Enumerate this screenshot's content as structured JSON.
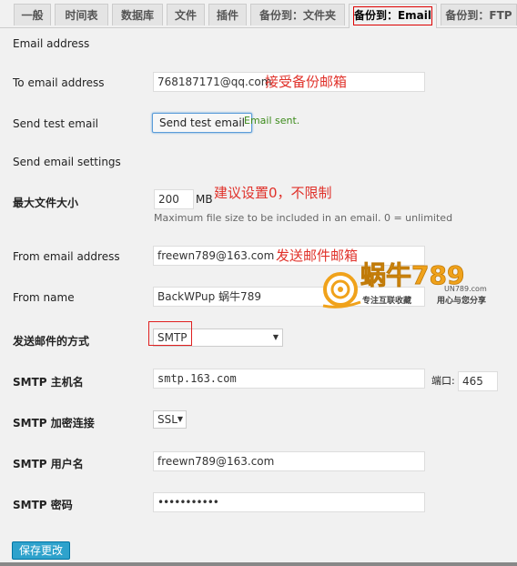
{
  "tabs": [
    "一般",
    "时间表",
    "数据库",
    "文件",
    "插件",
    "备份到：文件夹",
    "备份到：Email",
    "备份到：FTP"
  ],
  "sections": {
    "email_address": "Email address",
    "send_test_email": "Send test email",
    "send_email_settings": "Send email settings"
  },
  "fields": {
    "to_email_label": "To email address",
    "to_email_value": "768187171@qq.com",
    "test_button": "Send test email",
    "test_status": "Email sent.",
    "max_size_label": "最大文件大小",
    "max_size_value": "200",
    "max_size_unit": "MB",
    "max_size_help": "Maximum file size to be included in an email. 0 = unlimited",
    "from_email_label": "From email address",
    "from_email_value": "freewn789@163.com",
    "from_name_label": "From name",
    "from_name_value": "BackWPup 蜗牛789",
    "method_label": "发送邮件的方式",
    "method_value": "SMTP",
    "smtp_host_label": "SMTP 主机名",
    "smtp_host_value": "smtp.163.com",
    "port_label": "端口:",
    "port_value": "465",
    "smtp_secure_label": "SMTP 加密连接",
    "smtp_secure_value": "SSL",
    "smtp_user_label": "SMTP 用户名",
    "smtp_user_value": "freewn789@163.com",
    "smtp_pass_label": "SMTP 密码",
    "smtp_pass_value": "•••••••••••"
  },
  "annotations": {
    "receive": "接受备份邮箱",
    "limit": "建议设置0，不限制",
    "send": "发送邮件邮箱"
  },
  "watermark": {
    "title": "蜗牛789",
    "domain": "UN789.com",
    "slogan_left": "专注互联收藏",
    "slogan_right": "用心与您分享"
  },
  "submit": "保存更改",
  "colors": {
    "annotation": "#e0312a",
    "primary": "#2ea2cc",
    "success": "#3b8a1a"
  }
}
